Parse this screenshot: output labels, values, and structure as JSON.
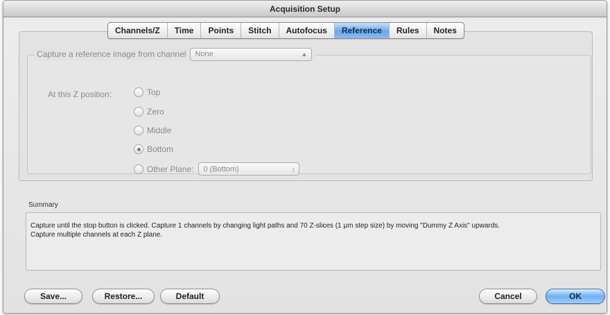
{
  "window": {
    "title": "Acquisition Setup"
  },
  "tabs": [
    {
      "label": "Channels/Z",
      "active": false
    },
    {
      "label": "Time",
      "active": false
    },
    {
      "label": "Points",
      "active": false
    },
    {
      "label": "Stitch",
      "active": false
    },
    {
      "label": "Autofocus",
      "active": false
    },
    {
      "label": "Reference",
      "active": true
    },
    {
      "label": "Rules",
      "active": false
    },
    {
      "label": "Notes",
      "active": false
    }
  ],
  "reference": {
    "capture_label": "Capture a reference image from channel",
    "channel_value": "None",
    "z_label": "At this Z position:",
    "options": [
      "Top",
      "Zero",
      "Middle",
      "Bottom",
      "Other Plane:"
    ],
    "selected_option": "Bottom",
    "other_plane_value": "0 (Bottom)"
  },
  "summary": {
    "label": "Summary",
    "text_line1": "Capture until the stop button is clicked.  Capture 1 channels by changing light paths and 70 Z-slices (1 µm step size) by moving \"Dummy Z Axis\" upwards.",
    "text_line2": "Capture multiple channels at each Z plane."
  },
  "buttons": {
    "save": "Save...",
    "restore": "Restore...",
    "default": "Default",
    "cancel": "Cancel",
    "ok": "OK"
  },
  "colors": {
    "active_tab": "#6aa7ea",
    "default_button": "#6fb0f2",
    "disabled_text": "#8a8a8a"
  }
}
